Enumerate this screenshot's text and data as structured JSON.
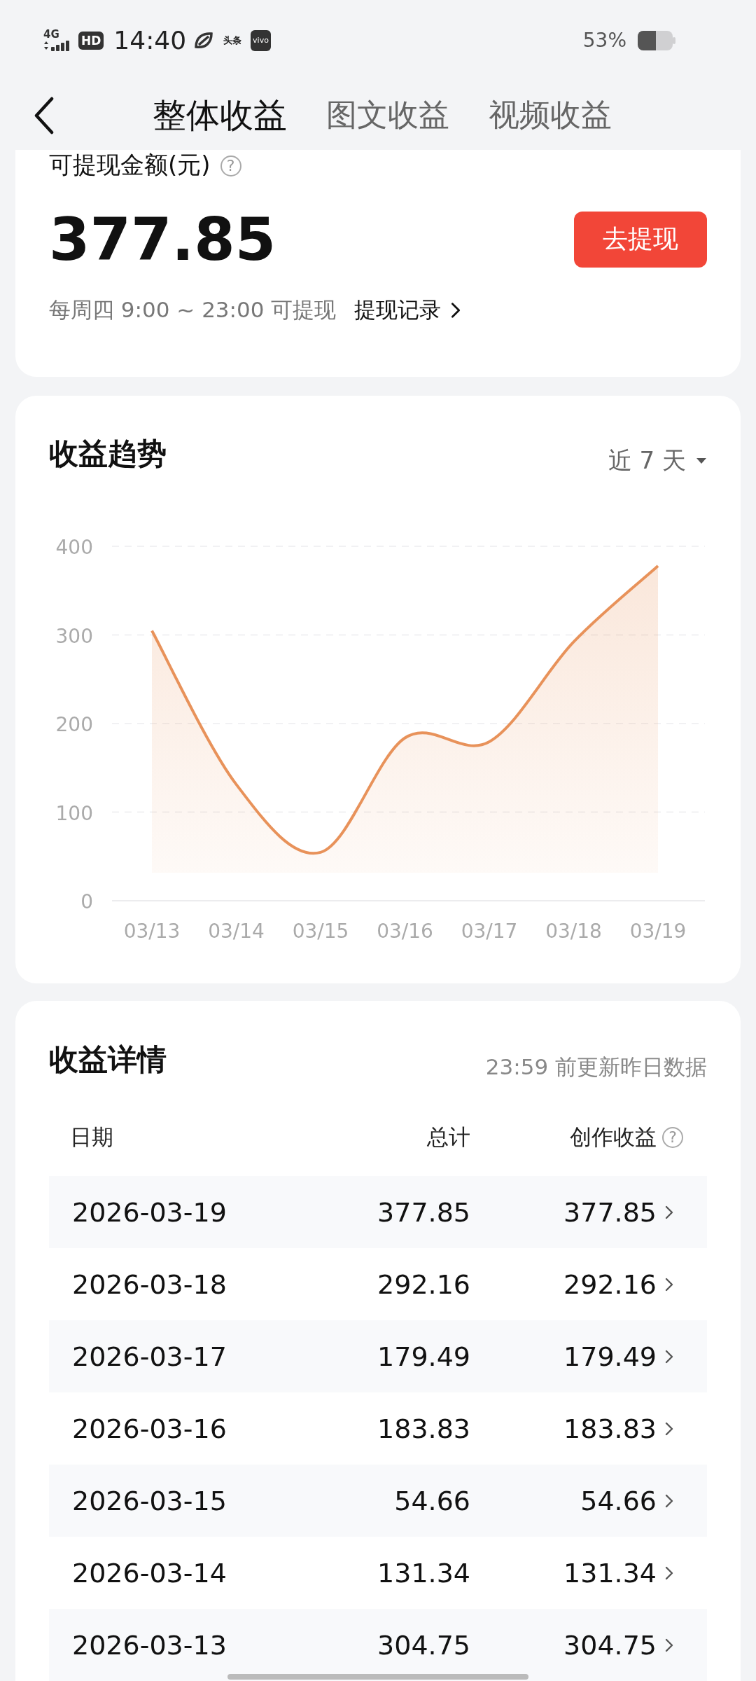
{
  "status_bar": {
    "network": "4G",
    "hd": "HD",
    "time": "14:40",
    "app_badges": [
      "头条",
      "vivo"
    ],
    "battery_text": "53%"
  },
  "nav": {
    "tabs": [
      {
        "label": "整体收益",
        "selected": true
      },
      {
        "label": "图文收益",
        "selected": false
      },
      {
        "label": "视频收益",
        "selected": false
      }
    ]
  },
  "balance": {
    "label": "可提现金额(元)",
    "help": "?",
    "amount": "377.85",
    "button": "去提现",
    "schedule": "每周四 9:00 ~ 23:00 可提现",
    "history_link": "提现记录"
  },
  "trend": {
    "title": "收益趋势",
    "range": "近 7 天",
    "chart_data": {
      "type": "area",
      "categories": [
        "03/13",
        "03/14",
        "03/15",
        "03/16",
        "03/17",
        "03/18",
        "03/19"
      ],
      "series": [
        {
          "color": "#e8925a",
          "values": [
            304.75,
            131.34,
            54.66,
            183.83,
            179.49,
            292.16,
            377.85
          ]
        }
      ],
      "ylim": [
        0,
        400
      ],
      "yticks": [
        0,
        100,
        200,
        300,
        400
      ],
      "grid": true
    }
  },
  "details": {
    "title": "收益详情",
    "note": "23:59 前更新昨日数据",
    "columns": [
      {
        "label": "日期"
      },
      {
        "label": "总计"
      },
      {
        "label": "创作收益",
        "help": "?"
      }
    ],
    "rows": [
      {
        "date": "2026-03-19",
        "total": "377.85",
        "creation": "377.85"
      },
      {
        "date": "2026-03-18",
        "total": "292.16",
        "creation": "292.16"
      },
      {
        "date": "2026-03-17",
        "total": "179.49",
        "creation": "179.49"
      },
      {
        "date": "2026-03-16",
        "total": "183.83",
        "creation": "183.83"
      },
      {
        "date": "2026-03-15",
        "total": "54.66",
        "creation": "54.66"
      },
      {
        "date": "2026-03-14",
        "total": "131.34",
        "creation": "131.34"
      },
      {
        "date": "2026-03-13",
        "total": "304.75",
        "creation": "304.75"
      }
    ]
  }
}
